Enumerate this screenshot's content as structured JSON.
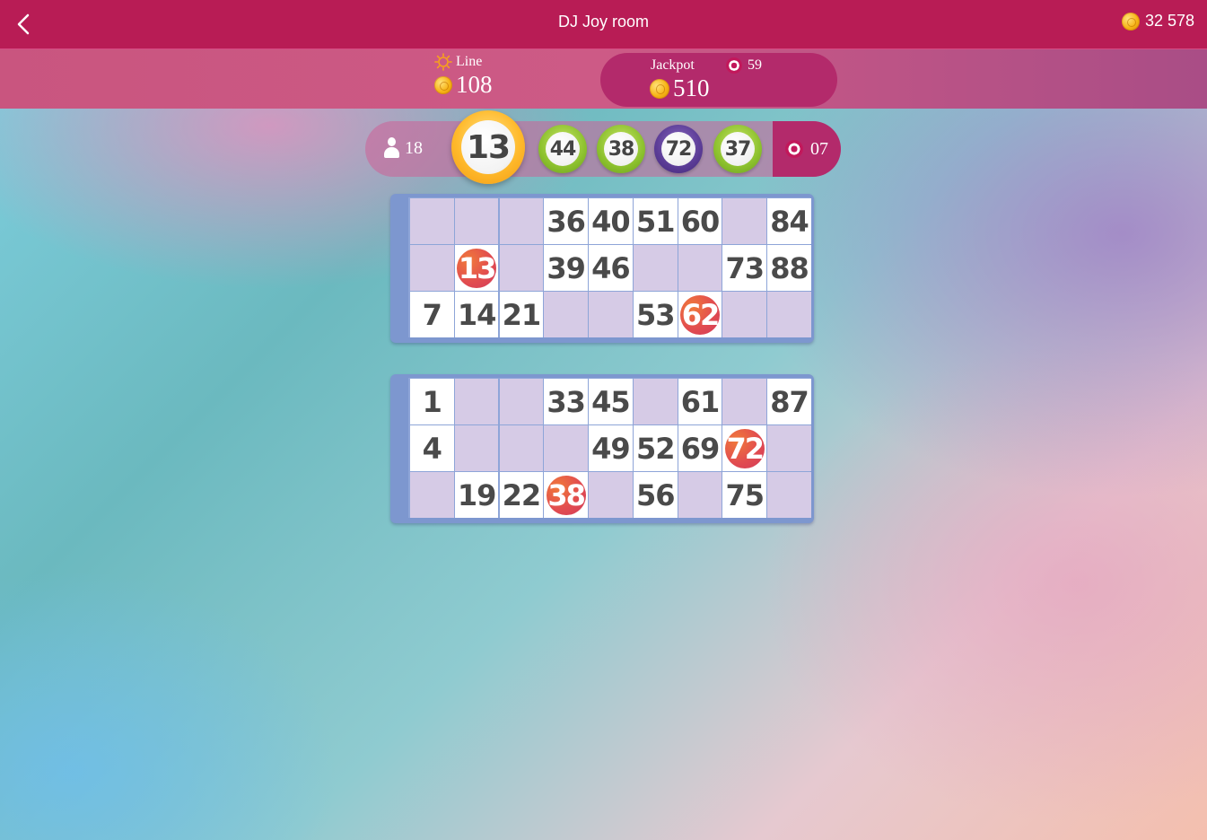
{
  "header": {
    "title": "DJ Joy room",
    "balance": "32 578"
  },
  "pots": {
    "line_label": "Line",
    "line_value": "108",
    "jackpot_label": "Jackpot",
    "jackpot_target": "59",
    "jackpot_value": "510"
  },
  "draw": {
    "players": "18",
    "current_ball": "13",
    "history": [
      "44",
      "38",
      "72",
      "37"
    ],
    "balls_remaining": "07"
  },
  "cards": [
    {
      "rows": [
        [
          "",
          "",
          "",
          "36",
          "40",
          "51",
          "60",
          "",
          "84"
        ],
        [
          "",
          "13",
          "",
          "39",
          "46",
          "",
          "",
          "73",
          "88"
        ],
        [
          "7",
          "14",
          "21",
          "",
          "",
          "53",
          "62",
          "",
          ""
        ]
      ],
      "marked": [
        "13",
        "62"
      ]
    },
    {
      "rows": [
        [
          "1",
          "",
          "",
          "33",
          "45",
          "",
          "61",
          "",
          "87"
        ],
        [
          "4",
          "",
          "",
          "",
          "49",
          "52",
          "69",
          "72",
          ""
        ],
        [
          "",
          "19",
          "22",
          "38",
          "",
          "56",
          "",
          "75",
          ""
        ]
      ],
      "marked": [
        "72",
        "38"
      ]
    }
  ],
  "colors": {
    "topbar": "#b81c55",
    "card_frame": "#7d97cf",
    "empty_cell": "#d6cbe6",
    "marked_ball": "#e24d4f",
    "current_ball_ring": "#ffba2c"
  },
  "icons": {
    "back": "chevron-left-icon",
    "coin": "coin-icon",
    "line": "sun-icon",
    "target": "target-icon",
    "players": "person-icon"
  }
}
